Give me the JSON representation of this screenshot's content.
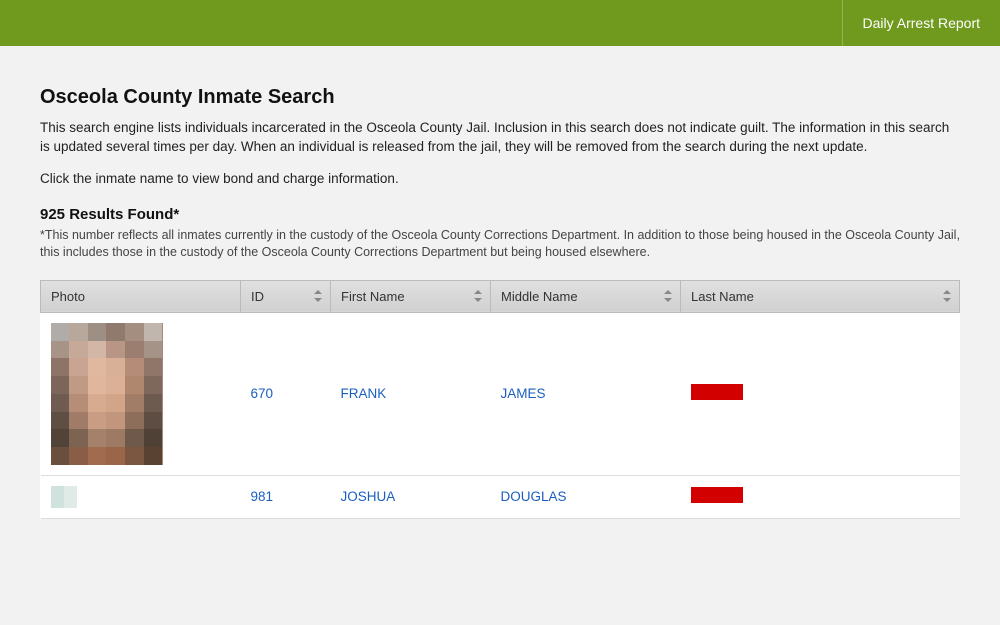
{
  "topbar": {
    "daily_report": "Daily Arrest Report"
  },
  "page": {
    "title": "Osceola County Inmate Search",
    "description": "This search engine lists individuals incarcerated in the Osceola County Jail. Inclusion in this search does not indicate guilt. The information in this search is updated several times per day. When an individual is released from the jail, they will be removed from the search during the next update.",
    "hint": "Click the inmate name to view bond and charge information.",
    "results_count": "925 Results Found*",
    "results_note": "*This number reflects all inmates currently in the custody of the Osceola County Corrections Department. In addition to those being housed in the Osceola County Jail, this includes those in the custody of the Osceola County Corrections Department but being housed elsewhere."
  },
  "table": {
    "headers": {
      "photo": "Photo",
      "id": "ID",
      "first_name": "First Name",
      "middle_name": "Middle Name",
      "last_name": "Last Name"
    },
    "rows": [
      {
        "id": "670",
        "first_name": "FRANK",
        "middle_name": "JAMES",
        "last_name_redacted": true,
        "photo_type": "large"
      },
      {
        "id": "981",
        "first_name": "JOSHUA",
        "middle_name": "DOUGLAS",
        "last_name_redacted": true,
        "photo_type": "small"
      }
    ]
  },
  "pixel_palette": [
    "#b0aca9",
    "#b8a79b",
    "#9e8f85",
    "#8f7a6d",
    "#a38e80",
    "#c0b6ad",
    "#a89486",
    "#c6a998",
    "#d2b6a6",
    "#b89584",
    "#9b7e70",
    "#a69388",
    "#8e7467",
    "#c9a492",
    "#dfb89f",
    "#d8b098",
    "#b58c78",
    "#8f7668",
    "#7c6559",
    "#c19a85",
    "#e0b79d",
    "#dcb096",
    "#af876f",
    "#7e685b",
    "#6f5b4f",
    "#b68e78",
    "#d7ab90",
    "#d2a589",
    "#a17d67",
    "#6e5b4f",
    "#5f4e43",
    "#a07c68",
    "#c89d83",
    "#c1967c",
    "#8d6e5b",
    "#5e4d42",
    "#514337",
    "#7d6352",
    "#a5816b",
    "#9d7a64",
    "#6f594a",
    "#4f4136",
    "#6a4f3e",
    "#8a5d46",
    "#a06b4f",
    "#996649",
    "#7b5640",
    "#5a4233"
  ]
}
